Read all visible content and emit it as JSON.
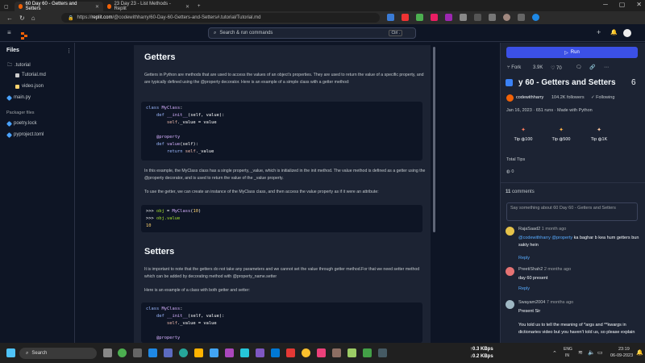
{
  "browser": {
    "tabs": [
      {
        "title": "60 Day 60 - Getters and Setters",
        "active": true
      },
      {
        "title": "23 Day 23 - List Methods - Replit",
        "active": false
      }
    ],
    "url_prefix": "https://",
    "url_domain": "replit.com",
    "url_path": "/@codewithharry/60-Day-60-Getters-and-Setters#.tutorial/Tutorial.md"
  },
  "header": {
    "search_placeholder": "Search & run commands",
    "search_shortcut": "Ctrl ."
  },
  "files": {
    "title": "Files",
    "items": [
      {
        "label": ".tutorial",
        "type": "folder"
      },
      {
        "label": "Tutorial.md",
        "type": "md"
      },
      {
        "label": "video.json",
        "type": "json"
      },
      {
        "label": "main.py",
        "type": "py"
      }
    ],
    "packager_title": "Packager files",
    "packager_items": [
      "poetry.lock",
      "pyproject.toml"
    ]
  },
  "tutorial": {
    "h_getters": "Getters",
    "p1": "Getters in Python are methods that are used to access the values of an object's properties. They are used to return the value of a specific property, and are typically defined using the @property decorator. Here is an example of a simple class with a getter method:",
    "code1": [
      "class MyClass:",
      "    def __init__(self, value):",
      "        self._value = value",
      "",
      "    @property",
      "    def value(self):",
      "        return self._value"
    ],
    "p2": "In this example, the MyClass class has a single property, _value, which is initialized in the init method. The value method is defined as a getter using the @property decorator, and is used to return the value of the _value property.",
    "p3": "To use the getter, we can create an instance of the MyClass class, and then access the value property as if it were an attribute:",
    "code2": [
      ">>> obj = MyClass(10)",
      ">>> obj.value",
      "10"
    ],
    "h_setters": "Setters",
    "p4": "It is important to note that the getters do not take any parameters and we cannot set the value through getter method.For that we need setter method which can be added by decorating method with @property_name.setter",
    "p5": "Here is an example of a class with both getter and setter:",
    "code3": [
      "class MyClass:",
      "    def __init__(self, value):",
      "        self._value = value",
      "",
      "    @property"
    ]
  },
  "repl": {
    "run_label": "Run",
    "fork_label": "Fork",
    "fork_count": "3.9K",
    "likes_count": "70",
    "title": "y 60 - Getters and Setters",
    "title_overflow": "6",
    "author": "codewithharry",
    "followers": "104.2K followers",
    "following_label": "Following",
    "meta": "Jan 16, 2023 · 651 runs · Made with Python",
    "tips": [
      {
        "label": "Tip",
        "amount": "100"
      },
      {
        "label": "Tip",
        "amount": "500"
      },
      {
        "label": "Tip",
        "amount": "1K"
      }
    ],
    "total_tips_title": "Total Tips",
    "total_tips": "0",
    "comments_count": "11",
    "comments_label": "comments",
    "comment_placeholder": "Say something about 60 Day 60 - Getters and Setters",
    "comments": [
      {
        "name": "RajaSaad2",
        "time": "1 month ago",
        "mention": "@codewithharry",
        "mention2": "@property",
        "text_a": " ",
        "text_b": " ka baghar b kea hum getters bun sakty hein",
        "reply": "Reply"
      },
      {
        "name": "PreetiShah2",
        "time": "2 months ago",
        "text": "day 60 present",
        "reply": "Reply"
      },
      {
        "name": "Swayam2004",
        "time": "7 months ago",
        "text": "Present Sir",
        "text2": "You told us to tell the meaning of *args and **kwargs in dictionaries video but you haven't told us, so please explain"
      }
    ]
  },
  "taskbar": {
    "search_label": "Search",
    "net_up": "0.3 KBps",
    "net_down": "0.2 KBps",
    "lang_top": "ENG",
    "lang_bottom": "IN",
    "time": "23:19",
    "date": "06-09-2023"
  },
  "colors": {
    "bg": "#0e1525",
    "panel": "#1c2333",
    "run": "#3b50e6",
    "link": "#57abff",
    "accent_orange": "#f26207"
  }
}
